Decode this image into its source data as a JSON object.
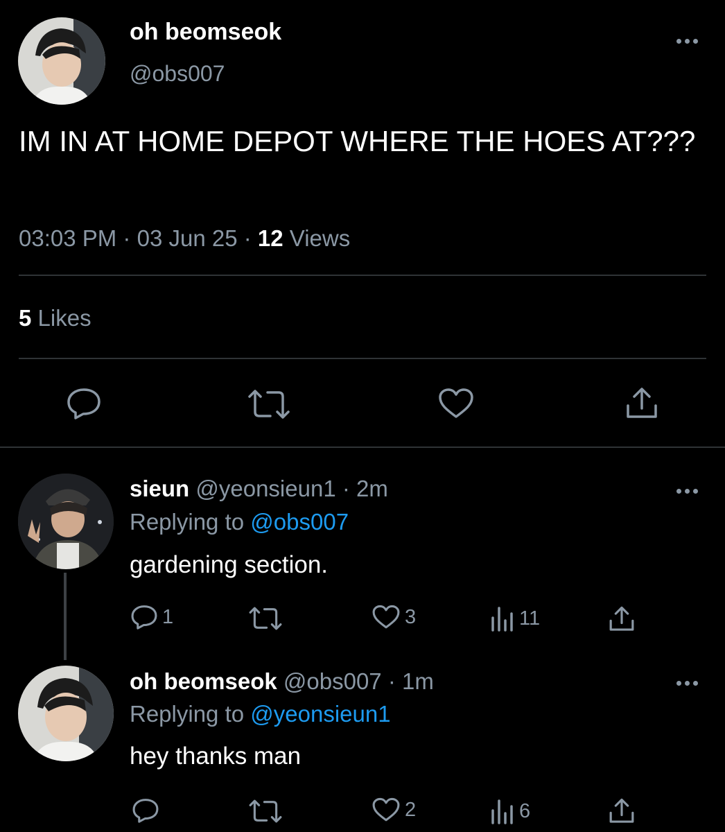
{
  "main_tweet": {
    "author_name": "oh beomseok",
    "author_handle": "@obs007",
    "text": "IM IN AT HOME DEPOT WHERE THE HOES AT???",
    "time": "03:03 PM",
    "date": "03 Jun 25",
    "views_count": "12",
    "views_label": "Views",
    "likes_count": "5",
    "likes_label": "Likes",
    "separator": "·"
  },
  "replies": [
    {
      "author_name": "sieun",
      "author_handle": "@yeonsieun1",
      "time_ago": "2m",
      "replying_prefix": "Replying to",
      "replying_to": "@obs007",
      "text": "gardening section.",
      "reply_count": "1",
      "like_count": "3",
      "view_count": "11"
    },
    {
      "author_name": "oh beomseok",
      "author_handle": "@obs007",
      "time_ago": "1m",
      "replying_prefix": "Replying to",
      "replying_to": "@yeonsieun1",
      "text": "hey thanks man",
      "like_count": "2",
      "view_count": "6"
    }
  ],
  "icons": [
    "reply-icon",
    "retweet-icon",
    "like-icon",
    "share-icon",
    "views-icon",
    "more-icon"
  ],
  "colors": {
    "background": "#000000",
    "muted": "#8b98a5",
    "link": "#1d9bf0",
    "divider": "#2f3336"
  }
}
